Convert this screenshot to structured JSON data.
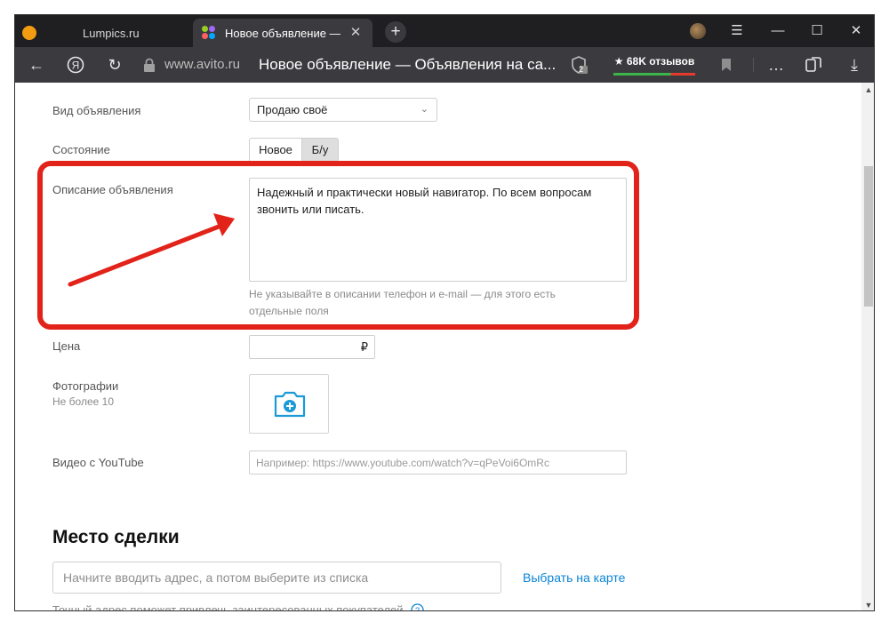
{
  "browser": {
    "tabs": [
      {
        "title": "Lumpics.ru",
        "active": false
      },
      {
        "title": "Новое объявление — О",
        "active": true
      }
    ],
    "window_controls": [
      "menu-icon",
      "minimize-icon",
      "maximize-icon",
      "close-icon"
    ],
    "address": {
      "domain": "www.avito.ru",
      "page_title": "Новое объявление — Объявления на са..."
    },
    "protect_badge": "2",
    "reviews_label": "★ 68K отзывов"
  },
  "form": {
    "ad_type": {
      "label": "Вид объявления",
      "value": "Продаю своё"
    },
    "condition": {
      "label": "Состояние",
      "options": [
        "Новое",
        "Б/у"
      ],
      "selected": "Новое"
    },
    "description": {
      "label": "Описание объявления",
      "value": "Надежный и практически новый навигатор. По всем вопросам звонить или писать.",
      "hint": "Не указывайте в описании телефон и e-mail — для этого есть отдельные поля"
    },
    "price": {
      "label": "Цена",
      "currency": "₽"
    },
    "photos": {
      "label": "Фотографии",
      "sub": "Не более 10"
    },
    "youtube": {
      "label": "Видео с YouTube",
      "placeholder": "Например: https://www.youtube.com/watch?v=qPeVoi6OmRc"
    }
  },
  "deal": {
    "title": "Место сделки",
    "address_placeholder": "Начните вводить адрес, а потом выберите из списка",
    "map_link": "Выбрать на карте",
    "cut_text": "Точный адрес поможет привлечь заинтересованных покупателей"
  },
  "colors": {
    "annotation_red": "#e2231a",
    "link": "#0a84d6",
    "camera": "#1a9ad6"
  }
}
